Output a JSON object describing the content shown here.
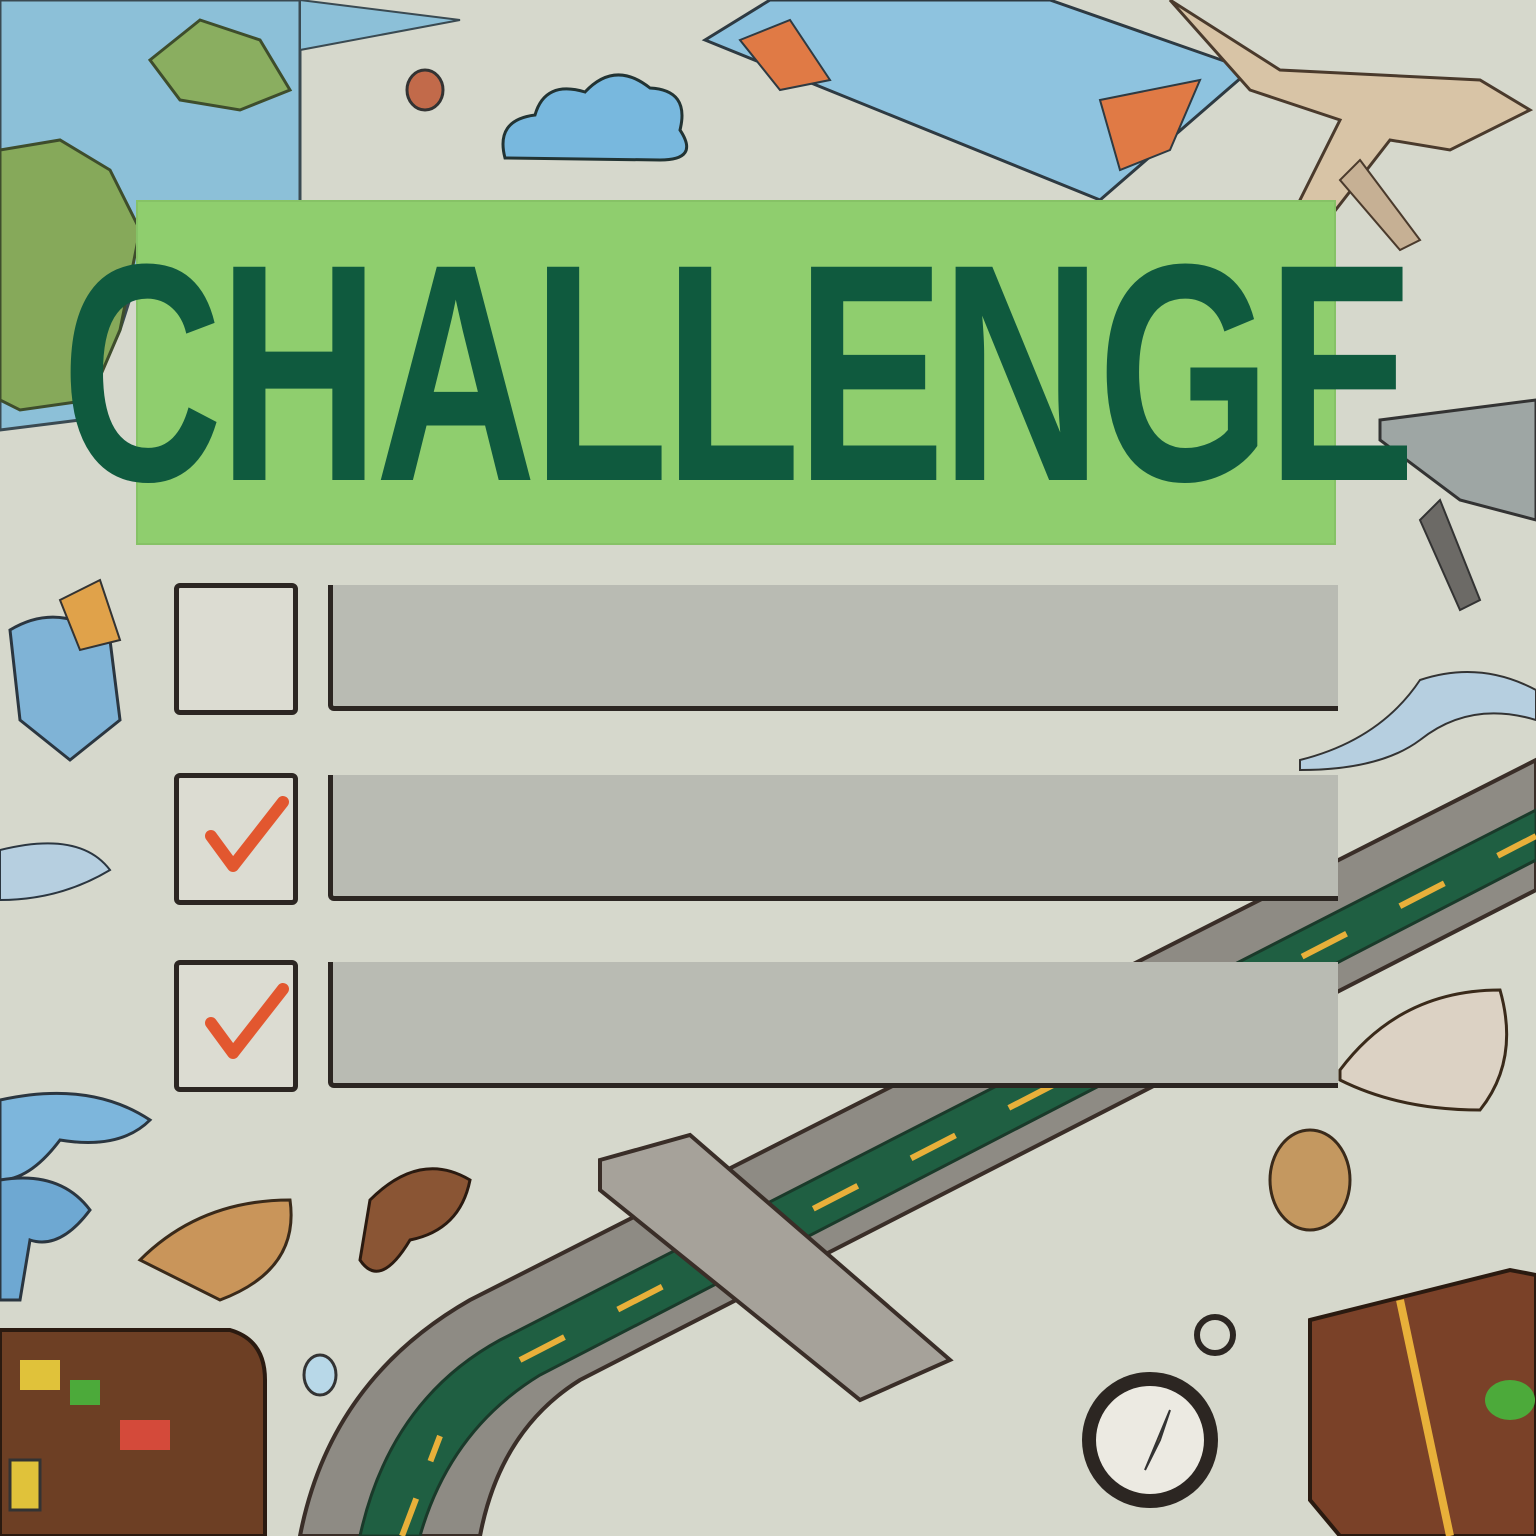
{
  "poster": {
    "title": "CHALLENGE"
  },
  "checklist": {
    "items": [
      {
        "checked": false,
        "text": ""
      },
      {
        "checked": true,
        "text": ""
      },
      {
        "checked": true,
        "text": ""
      }
    ]
  },
  "colors": {
    "background": "#d6d8cc",
    "banner": "#8fce6e",
    "title_text": "#0f5a3e",
    "checkmark": "#e2572f",
    "road": "#1f5f42",
    "road_edge": "#8e8b84",
    "road_dash": "#e8b03a"
  },
  "illustrations": [
    "world-map-icon",
    "cloud-icon",
    "folded-map-icon",
    "airplane-icon",
    "road-icon",
    "suitcase-icon",
    "compass-icon",
    "wave-icon",
    "leaf-icon"
  ]
}
